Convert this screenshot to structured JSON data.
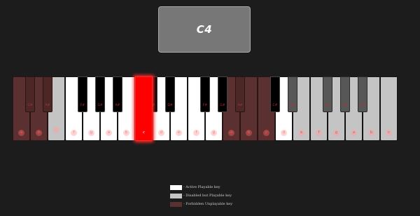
{
  "current_note": "C4",
  "white_keys": [
    {
      "label": "a",
      "state": "forbidden"
    },
    {
      "label": "b",
      "state": "forbidden"
    },
    {
      "label": "",
      "state": "disabled"
    },
    {
      "label": "f",
      "state": "active"
    },
    {
      "label": "g",
      "state": "active"
    },
    {
      "label": "a",
      "state": "active"
    },
    {
      "label": "b",
      "state": "active"
    },
    {
      "label": "c",
      "state": "pressed"
    },
    {
      "label": "d",
      "state": "active"
    },
    {
      "label": "e",
      "state": "active"
    },
    {
      "label": "f",
      "state": "active"
    },
    {
      "label": "g",
      "state": "active"
    },
    {
      "label": "a",
      "state": "forbidden"
    },
    {
      "label": "b",
      "state": "forbidden"
    },
    {
      "label": "c",
      "state": "forbidden"
    },
    {
      "label": "d",
      "state": "active"
    },
    {
      "label": "e",
      "state": "disabled"
    },
    {
      "label": "f",
      "state": "disabled"
    },
    {
      "label": "g",
      "state": "disabled"
    },
    {
      "label": "a",
      "state": "disabled"
    },
    {
      "label": "b",
      "state": "disabled"
    },
    {
      "label": "c",
      "state": "disabled"
    }
  ],
  "black_keys": [
    {
      "label": "G#",
      "state": "forbidden"
    },
    {
      "label": "A#",
      "state": "forbidden"
    },
    {
      "label": "F#",
      "state": "active"
    },
    {
      "label": "G#",
      "state": "active"
    },
    {
      "label": "A#",
      "state": "active"
    },
    {
      "label": "C#",
      "state": "active"
    },
    {
      "label": "D#",
      "state": "active"
    },
    {
      "label": "F#",
      "state": "active"
    },
    {
      "label": "G#",
      "state": "active"
    },
    {
      "label": "A#",
      "state": "forbidden"
    },
    {
      "label": "C#",
      "state": "active"
    },
    {
      "label": "D#",
      "state": "disabled"
    },
    {
      "label": "F#",
      "state": "disabled"
    },
    {
      "label": "G#",
      "state": "disabled"
    },
    {
      "label": "A#",
      "state": "disabled"
    }
  ],
  "legend": [
    {
      "label": "- Active Playable key",
      "color": "#ffffff"
    },
    {
      "label": "- Disabled but Playable key",
      "color": "#c4c4c4"
    },
    {
      "label": "- Forbidden Unplayable key",
      "color": "#5a3030"
    }
  ]
}
